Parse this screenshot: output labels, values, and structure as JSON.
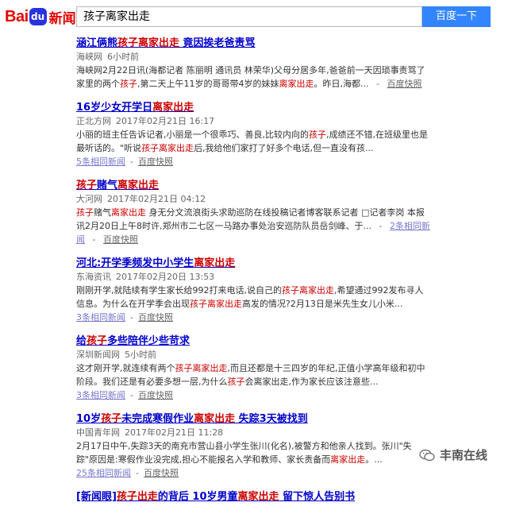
{
  "logo": {
    "part1": "Bai",
    "paw": "du",
    "part2": "新闻"
  },
  "search": {
    "query": "孩子离家出走",
    "button": "百度一下"
  },
  "results": [
    {
      "title": [
        {
          "t": "涵江俩熊",
          "hl": false
        },
        {
          "t": "孩子离家出走",
          "hl": true
        },
        {
          "t": " 竟因挨老爸责骂",
          "hl": false
        }
      ],
      "source": "海峡网",
      "time": "6小时前",
      "summary": [
        {
          "t": "海峡网2月22日讯(海都记者 陈丽明 通讯员 林荣华)父母分居多年,爸爸前一天因琐事责骂了家里的两个",
          "hl": false
        },
        {
          "t": "孩子",
          "hl": true
        },
        {
          "t": ",第二天上午11岁的哥哥带4岁的妹妹",
          "hl": false
        },
        {
          "t": "离家出走",
          "hl": true
        },
        {
          "t": "。昨日,海都...",
          "hl": false
        }
      ],
      "inline_links": [
        "百度快照"
      ]
    },
    {
      "title": [
        {
          "t": "16岁少女开学日",
          "hl": false
        },
        {
          "t": "离家出走",
          "hl": true
        }
      ],
      "source": "正北方网",
      "time": "2017年02月21日 16:17",
      "summary": [
        {
          "t": "小丽的班主任告诉记者,小丽是一个很乖巧、善良,比较内向的",
          "hl": false
        },
        {
          "t": "孩子",
          "hl": true
        },
        {
          "t": ",成绩还不错,在班级里也是最听话的。\"听说",
          "hl": false
        },
        {
          "t": "孩子离家出走",
          "hl": true
        },
        {
          "t": "后,我给他们家打了好多个电话,但一直没有孩...",
          "hl": false
        }
      ],
      "links": [
        "5条相同新闻",
        "百度快照"
      ]
    },
    {
      "title": [
        {
          "t": "孩子",
          "hl": true
        },
        {
          "t": "赌气",
          "hl": false
        },
        {
          "t": "离家出走",
          "hl": true
        }
      ],
      "source": "大河网",
      "time": "2017年02月21日 04:12",
      "summary": [
        {
          "t": "孩子",
          "hl": true
        },
        {
          "t": "赌气",
          "hl": false
        },
        {
          "t": "离家出走",
          "hl": true
        },
        {
          "t": " 身无分文流浪街头求助巡防在线投稿记者博客联系记者 □记者李岗 本报讯2月20日上午8时许,郑州市二七区一马路办事处治安巡防队员岳剑峰、于...",
          "hl": false
        }
      ],
      "inline_links": [
        "2条相同新闻",
        "百度快照"
      ]
    },
    {
      "title": [
        {
          "t": "河北:开学季频发中小学生",
          "hl": false
        },
        {
          "t": "离家出走",
          "hl": true
        }
      ],
      "source": "东海资讯",
      "time": "2017年02月20日 13:53",
      "summary": [
        {
          "t": "刚刚开学,就陆续有学生家长给992打来电话,说自己的",
          "hl": false
        },
        {
          "t": "孩子离家出走",
          "hl": true
        },
        {
          "t": ",希望通过992发布寻人信息。为什么在开学季会出现",
          "hl": false
        },
        {
          "t": "孩子离家出走",
          "hl": true
        },
        {
          "t": "高发的情况?2月13日是米先生女儿小米...",
          "hl": false
        }
      ],
      "links": [
        "3条相同新闻",
        "百度快照"
      ]
    },
    {
      "title": [
        {
          "t": "给",
          "hl": false
        },
        {
          "t": "孩子",
          "hl": true
        },
        {
          "t": "多些陪伴少些苛求",
          "hl": false
        }
      ],
      "source": "深圳新闻网",
      "time": "5小时前",
      "summary": [
        {
          "t": "这才刚开学,就连续有两个",
          "hl": false
        },
        {
          "t": "孩子离家出走",
          "hl": true
        },
        {
          "t": ",而且还都是十三四岁的年纪,正值小学高年级和初中阶段。我们还是有必要多想一层,为什么",
          "hl": false
        },
        {
          "t": "孩子",
          "hl": true
        },
        {
          "t": "会离家出走,作为家长应该注意些...",
          "hl": false
        }
      ],
      "links": [
        "3条相同新闻",
        "百度快照"
      ]
    },
    {
      "title": [
        {
          "t": "10岁",
          "hl": false
        },
        {
          "t": "孩子",
          "hl": true
        },
        {
          "t": "未完成寒假作业",
          "hl": false
        },
        {
          "t": "离家出走",
          "hl": true
        },
        {
          "t": " 失踪3天被找到",
          "hl": false
        }
      ],
      "source": "中国青年网",
      "time": "2017年02月21日 11:28",
      "summary": [
        {
          "t": "2月17日中午,失踪3天的南充市营山县小学生张川(化名),被警方和他亲人找到。张川\"失踪\"原因是:寒假作业没完成,担心不能报名入学和教师、家长责备而",
          "hl": false
        },
        {
          "t": "离家出走",
          "hl": true
        },
        {
          "t": "。...",
          "hl": false
        }
      ],
      "links": [
        "25条相同新闻",
        "百度快照"
      ]
    },
    {
      "title": [
        {
          "t": "[新闻眼]",
          "hl": false
        },
        {
          "t": "孩子出走",
          "hl": true
        },
        {
          "t": "的背后 10岁男童",
          "hl": false
        },
        {
          "t": "离家出走",
          "hl": true
        },
        {
          "t": " 留下惊人告别书",
          "hl": false
        }
      ]
    }
  ],
  "watermark": {
    "text": "丰南在线",
    "icon": "wechat-icon"
  }
}
